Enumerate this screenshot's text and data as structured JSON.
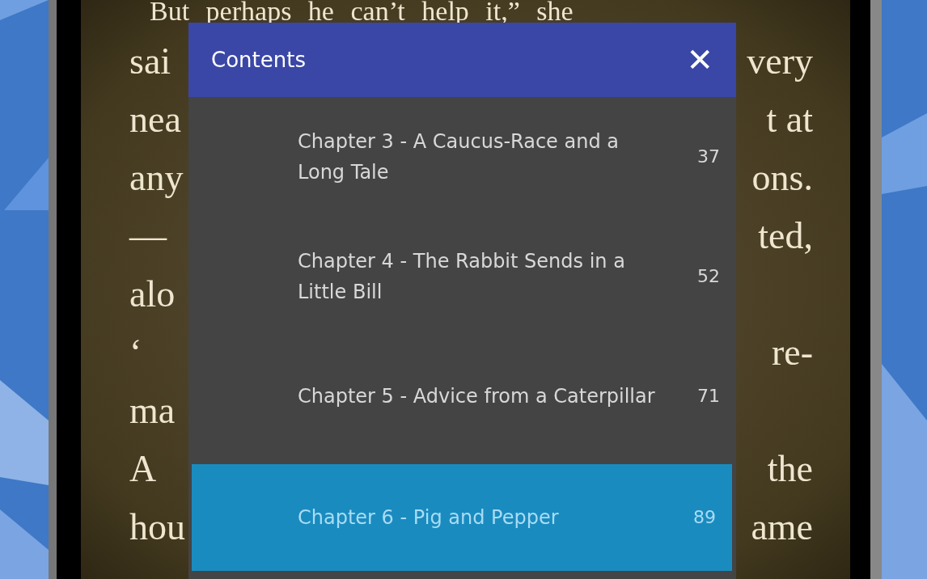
{
  "book_page": {
    "top_line": "But perhaps he can’t help it,” she",
    "lines": [
      {
        "left": "sai",
        "right": "very"
      },
      {
        "left": "nea",
        "right": "t at"
      },
      {
        "left": "any",
        "right": "ons."
      },
      {
        "left": "—",
        "right": "ted,"
      },
      {
        "left": "alo"
      },
      {
        "left": "‘",
        "right": "re-"
      },
      {
        "left": "ma"
      },
      {
        "left": "A",
        "right": "the"
      },
      {
        "left": "hou",
        "right": "ame"
      }
    ]
  },
  "dialog": {
    "title": "Contents",
    "close": "✕",
    "items": [
      {
        "title": "Chapter 3 - A Caucus-Race and a Long Tale",
        "page": "37",
        "selected": false
      },
      {
        "title": "Chapter 4 - The Rabbit Sends in a Little Bill",
        "page": "52",
        "selected": false
      },
      {
        "title": "Chapter 5 - Advice from a Caterpillar",
        "page": "71",
        "selected": false
      },
      {
        "title": "Chapter 6 - Pig and Pepper",
        "page": "89",
        "selected": true
      }
    ]
  }
}
